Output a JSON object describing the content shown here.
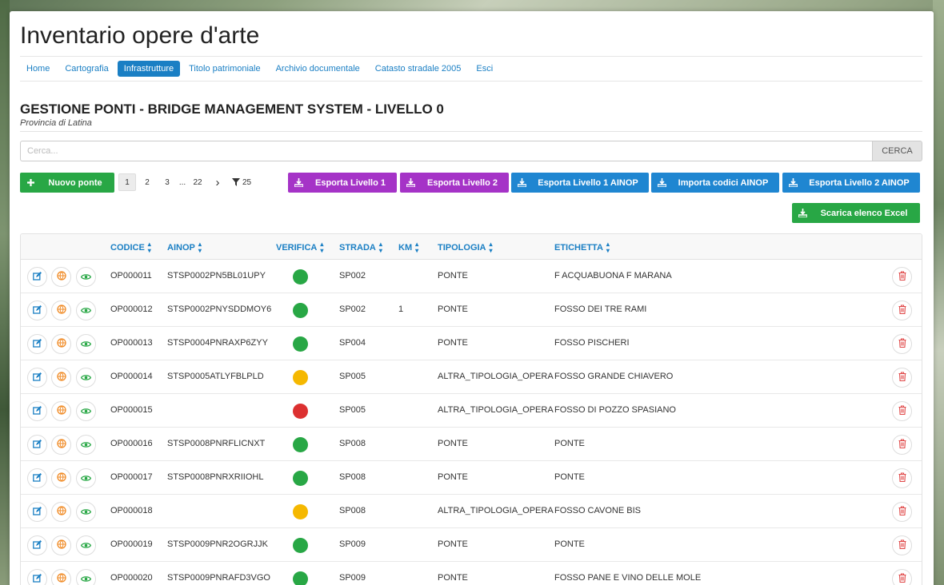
{
  "app": {
    "title": "Inventario opere d'arte"
  },
  "nav": {
    "items": [
      {
        "label": "Home",
        "active": false
      },
      {
        "label": "Cartografia",
        "active": false
      },
      {
        "label": "Infrastrutture",
        "active": true
      },
      {
        "label": "Titolo patrimoniale",
        "active": false
      },
      {
        "label": "Archivio documentale",
        "active": false
      },
      {
        "label": "Catasto stradale 2005",
        "active": false
      },
      {
        "label": "Esci",
        "active": false
      }
    ]
  },
  "page": {
    "title": "GESTIONE PONTI - BRIDGE MANAGEMENT SYSTEM - LIVELLO 0",
    "subtitle": "Provincia di Latina"
  },
  "search": {
    "placeholder": "Cerca...",
    "button_label": "CERCA"
  },
  "toolbar": {
    "new_label": "Nuovo ponte",
    "export1_label": "Esporta Livello 1",
    "export2_label": "Esporta Livello 2",
    "export1_ainop_label": "Esporta Livello 1 AINOP",
    "import_ainop_label": "Importa codici AINOP",
    "export2_ainop_label": "Esporta Livello 2 AINOP",
    "excel_label": "Scarica elenco Excel"
  },
  "pagination": {
    "pages": [
      "1",
      "2",
      "3"
    ],
    "ellipsis": "...",
    "last": "22",
    "next": "›",
    "per_page": "25"
  },
  "colors": {
    "green": "#28a745",
    "yellow": "#f5b800",
    "red": "#dc3030",
    "primary": "#1a7fc4",
    "purple": "#a533c7"
  },
  "table": {
    "headers": {
      "codice": "CODICE",
      "ainop": "AINOP",
      "verifica": "VERIFICA",
      "strada": "STRADA",
      "km": "KM",
      "tipologia": "TIPOLOGIA",
      "etichetta": "ETICHETTA"
    },
    "rows": [
      {
        "codice": "OP000011",
        "ainop": "STSP0002PN5BL01UPY",
        "verifica": "green",
        "strada": "SP002",
        "km": "",
        "tipologia": "PONTE",
        "etichetta": "F ACQUABUONA F MARANA"
      },
      {
        "codice": "OP000012",
        "ainop": "STSP0002PNYSDDMOY6",
        "verifica": "green",
        "strada": "SP002",
        "km": "1",
        "tipologia": "PONTE",
        "etichetta": "FOSSO DEI TRE RAMI"
      },
      {
        "codice": "OP000013",
        "ainop": "STSP0004PNRAXP6ZYY",
        "verifica": "green",
        "strada": "SP004",
        "km": "",
        "tipologia": "PONTE",
        "etichetta": "FOSSO PISCHERI"
      },
      {
        "codice": "OP000014",
        "ainop": "STSP0005ATLYFBLPLD",
        "verifica": "yellow",
        "strada": "SP005",
        "km": "",
        "tipologia": "ALTRA_TIPOLOGIA_OPERA",
        "etichetta": "FOSSO GRANDE CHIAVERO"
      },
      {
        "codice": "OP000015",
        "ainop": "",
        "verifica": "red",
        "strada": "SP005",
        "km": "",
        "tipologia": "ALTRA_TIPOLOGIA_OPERA",
        "etichetta": "FOSSO DI POZZO SPASIANO"
      },
      {
        "codice": "OP000016",
        "ainop": "STSP0008PNRFLICNXT",
        "verifica": "green",
        "strada": "SP008",
        "km": "",
        "tipologia": "PONTE",
        "etichetta": "PONTE"
      },
      {
        "codice": "OP000017",
        "ainop": "STSP0008PNRXRIIOHL",
        "verifica": "green",
        "strada": "SP008",
        "km": "",
        "tipologia": "PONTE",
        "etichetta": "PONTE"
      },
      {
        "codice": "OP000018",
        "ainop": "",
        "verifica": "yellow",
        "strada": "SP008",
        "km": "",
        "tipologia": "ALTRA_TIPOLOGIA_OPERA",
        "etichetta": "FOSSO CAVONE BIS"
      },
      {
        "codice": "OP000019",
        "ainop": "STSP0009PNR2OGRJJK",
        "verifica": "green",
        "strada": "SP009",
        "km": "",
        "tipologia": "PONTE",
        "etichetta": "PONTE"
      },
      {
        "codice": "OP000020",
        "ainop": "STSP0009PNRAFD3VGO",
        "verifica": "green",
        "strada": "SP009",
        "km": "",
        "tipologia": "PONTE",
        "etichetta": "FOSSO PANE E VINO DELLE MOLE"
      }
    ]
  }
}
